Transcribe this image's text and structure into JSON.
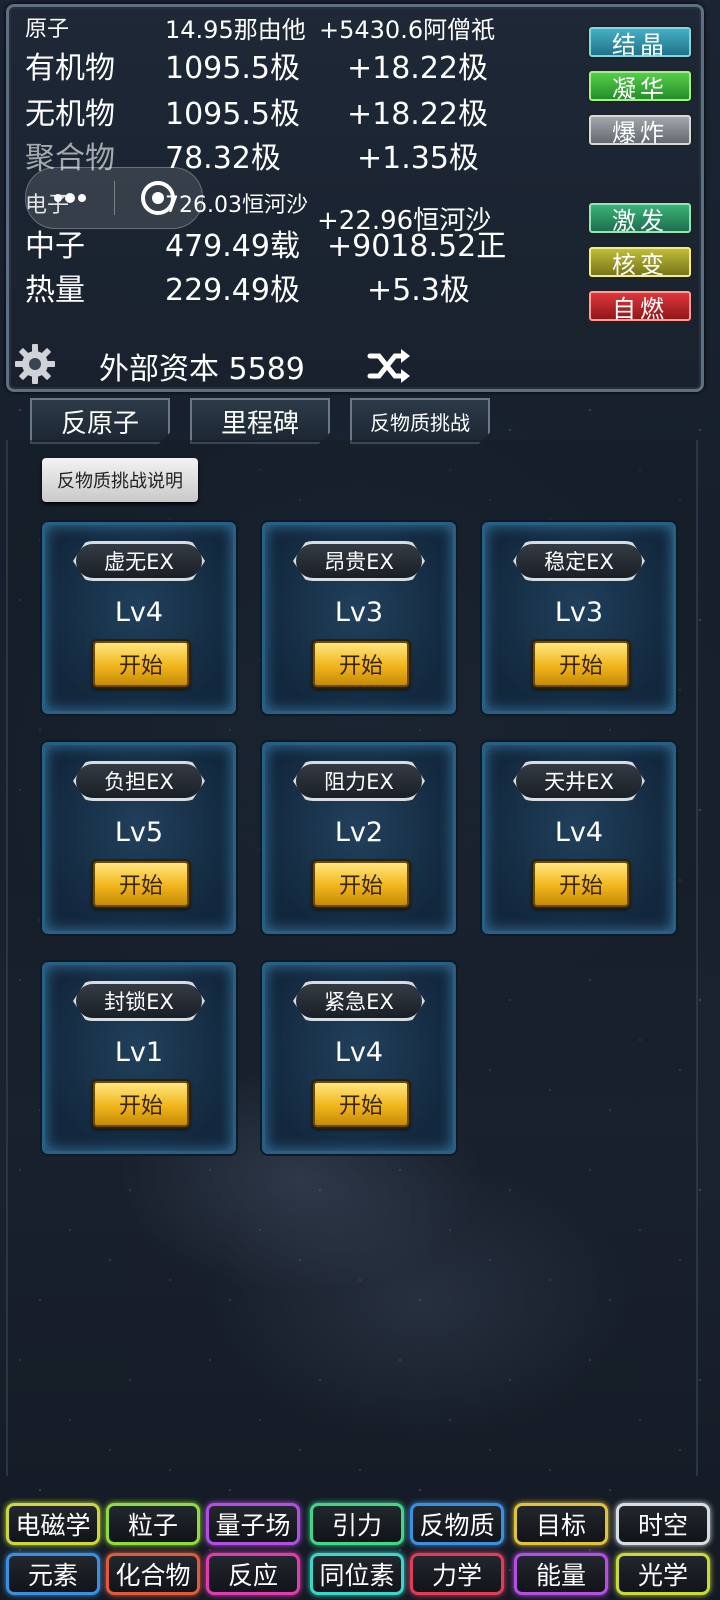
{
  "resources": [
    {
      "name": "原子",
      "value": "14.95那由他",
      "increment": "+5430.6阿僧祇",
      "size": "small"
    },
    {
      "name": "有机物",
      "value": "1095.5极",
      "increment": "+18.22极",
      "size": "big"
    },
    {
      "name": "无机物",
      "value": "1095.5极",
      "increment": "+18.22极",
      "size": "big"
    },
    {
      "name": "聚合物",
      "value": "78.32极",
      "increment": "+1.35极",
      "size": "big"
    },
    {
      "name": "电子",
      "value": "726.03恒河沙",
      "increment": "+22.96恒河沙",
      "size": "small"
    },
    {
      "name": "中子",
      "value": "479.49载",
      "increment": "+9018.52正",
      "size": "big"
    },
    {
      "name": "热量",
      "value": "229.49极",
      "increment": "+5.3极",
      "size": "big"
    }
  ],
  "actions": [
    {
      "label": "结晶",
      "color": "cyan"
    },
    {
      "label": "凝华",
      "color": "green"
    },
    {
      "label": "爆炸",
      "color": "grey"
    },
    {
      "label": "激发",
      "color": "teal"
    },
    {
      "label": "核变",
      "color": "yellow"
    },
    {
      "label": "自燃",
      "color": "red"
    }
  ],
  "capital": {
    "label": "外部资本",
    "value": "5589"
  },
  "tabs": [
    "反原子",
    "里程碑",
    "反物质挑战"
  ],
  "explain_label": "反物质挑战说明",
  "challenges": [
    {
      "name": "虚无EX",
      "level": "Lv4",
      "start": "开始"
    },
    {
      "name": "昂贵EX",
      "level": "Lv3",
      "start": "开始"
    },
    {
      "name": "稳定EX",
      "level": "Lv3",
      "start": "开始"
    },
    {
      "name": "负担EX",
      "level": "Lv5",
      "start": "开始"
    },
    {
      "name": "阻力EX",
      "level": "Lv2",
      "start": "开始"
    },
    {
      "name": "天井EX",
      "level": "Lv4",
      "start": "开始"
    },
    {
      "name": "封锁EX",
      "level": "Lv1",
      "start": "开始"
    },
    {
      "name": "紧急EX",
      "level": "Lv4",
      "start": "开始"
    }
  ],
  "nav_row1": [
    {
      "label": "电磁学",
      "color": "#c9d93a"
    },
    {
      "label": "粒子",
      "color": "#8fdc3b"
    },
    {
      "label": "量子场",
      "color": "#b04fe0"
    },
    {
      "label": "引力",
      "color": "#3fd68a"
    },
    {
      "label": "反物质",
      "color": "#3b8fe0"
    },
    {
      "label": "目标",
      "color": "#e0c23b"
    },
    {
      "label": "时空",
      "color": "#d8dde2"
    }
  ],
  "nav_row2": [
    {
      "label": "元素",
      "color": "#3b8fe0"
    },
    {
      "label": "化合物",
      "color": "#e05a3b"
    },
    {
      "label": "反应",
      "color": "#e03bb0"
    },
    {
      "label": "同位素",
      "color": "#3bd6c7"
    },
    {
      "label": "力学",
      "color": "#e03b5a"
    },
    {
      "label": "能量",
      "color": "#b44fe0"
    },
    {
      "label": "光学",
      "color": "#c9d93a"
    }
  ]
}
